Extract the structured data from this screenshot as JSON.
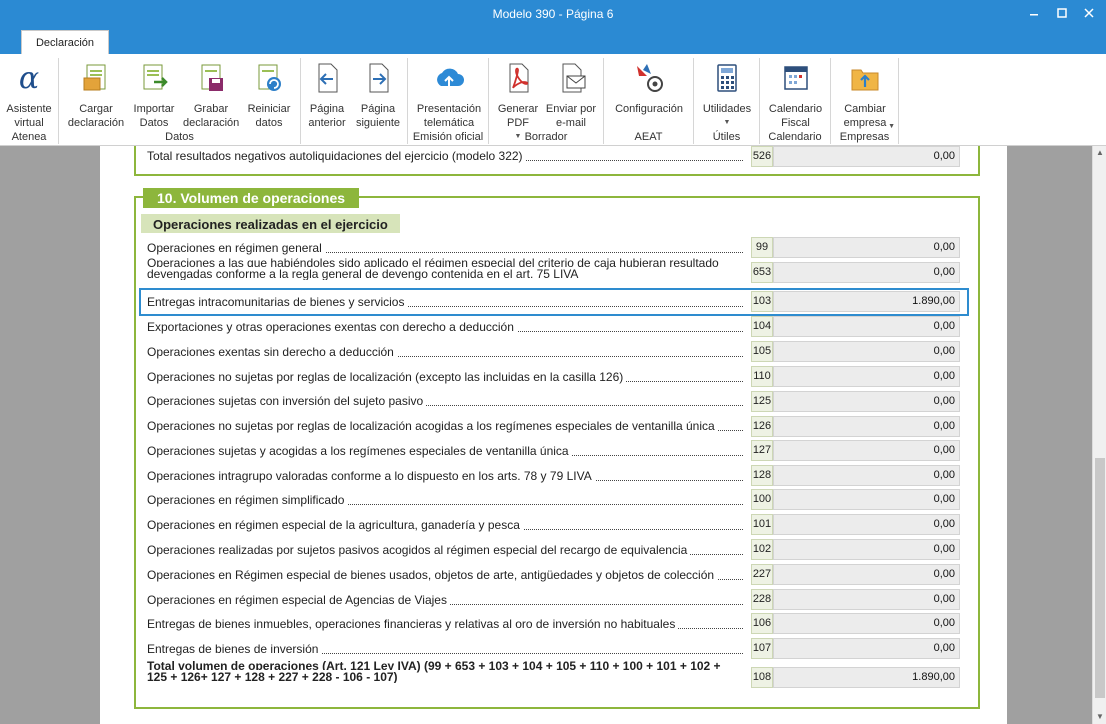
{
  "window": {
    "title": "Modelo 390 - Página 6"
  },
  "tabs": {
    "active": "Declaración"
  },
  "ribbon": {
    "buttons": {
      "asistente": "Asistente virtual",
      "cargar": "Cargar declaración",
      "importar": "Importar Datos",
      "grabar": "Grabar declaración",
      "reiniciar": "Reiniciar datos",
      "anterior": "Página anterior",
      "siguiente": "Página siguiente",
      "presentacion": "Presentación telemática",
      "generar": "Generar PDF",
      "enviar": "Enviar por e-mail",
      "configuracion": "Configuración",
      "utilidades": "Utilidades",
      "calendario": "Calendario Fiscal",
      "cambiar": "Cambiar empresa"
    },
    "groups": {
      "atenea": "Atenea",
      "datos": "Datos",
      "emision": "Emisión oficial",
      "borrador": "Borrador",
      "aeat": "AEAT",
      "utiles": "Útiles",
      "calendario": "Calendario",
      "empresas": "Empresas"
    }
  },
  "form": {
    "prev_row": {
      "label": "Total resultados negativos autoliquidaciones del ejercicio (modelo 322)",
      "code": "526",
      "value": "0,00"
    },
    "section_title": "10. Volumen de operaciones",
    "subsection_title": "Operaciones realizadas en el ejercicio",
    "rows": [
      {
        "label": "Operaciones en régimen general",
        "code": "99",
        "value": "0,00"
      },
      {
        "label": "Operaciones a las que habiéndoles sido aplicado el régimen especial del criterio de caja hubieran resultado devengadas conforme a la regla general de devengo contenida en el art. 75 LIVA",
        "code": "653",
        "value": "0,00"
      },
      {
        "label": "Entregas intracomunitarias de bienes y servicios",
        "code": "103",
        "value": "1.890,00"
      },
      {
        "label": "Exportaciones y otras operaciones exentas con derecho a deducción",
        "code": "104",
        "value": "0,00"
      },
      {
        "label": "Operaciones exentas sin derecho a deducción",
        "code": "105",
        "value": "0,00"
      },
      {
        "label": "Operaciones no sujetas por reglas de localización (excepto las incluidas en la casilla 126)",
        "code": "110",
        "value": "0,00"
      },
      {
        "label": "Operaciones sujetas con inversión del sujeto pasivo",
        "code": "125",
        "value": "0,00"
      },
      {
        "label": "Operaciones no sujetas por reglas de localización acogidas a los regímenes especiales de ventanilla única",
        "code": "126",
        "value": "0,00"
      },
      {
        "label": "Operaciones sujetas y acogidas a los regímenes especiales de ventanilla única",
        "code": "127",
        "value": "0,00"
      },
      {
        "label": "Operaciones intragrupo valoradas conforme a lo dispuesto en los arts. 78 y 79 LIVA",
        "code": "128",
        "value": "0,00"
      },
      {
        "label": "Operaciones en régimen simplificado",
        "code": "100",
        "value": "0,00"
      },
      {
        "label": "Operaciones en régimen especial de la agricultura, ganadería y pesca",
        "code": "101",
        "value": "0,00"
      },
      {
        "label": "Operaciones realizadas por sujetos pasivos acogidos al régimen especial del recargo de equivalencia",
        "code": "102",
        "value": "0,00"
      },
      {
        "label": "Operaciones en Régimen especial de bienes usados, objetos  de arte, antigüedades  y objetos de colección",
        "code": "227",
        "value": "0,00"
      },
      {
        "label": "Operaciones en régimen especial de Agencias de Viajes",
        "code": "228",
        "value": "0,00"
      },
      {
        "label": "Entregas de bienes inmuebles, operaciones financieras y relativas al oro de inversión no habituales",
        "code": "106",
        "value": "0,00"
      },
      {
        "label": "Entregas de bienes de inversión",
        "code": "107",
        "value": "0,00"
      },
      {
        "label": "Total volumen de operaciones (Art. 121 Ley IVA) (99 + 653 + 103 + 104 + 105 + 110 + 100 + 101 + 102 + 125 + 126+ 127 + 128 + 227 + 228 - 106 - 107)",
        "code": "108",
        "value": "1.890,00"
      }
    ]
  }
}
